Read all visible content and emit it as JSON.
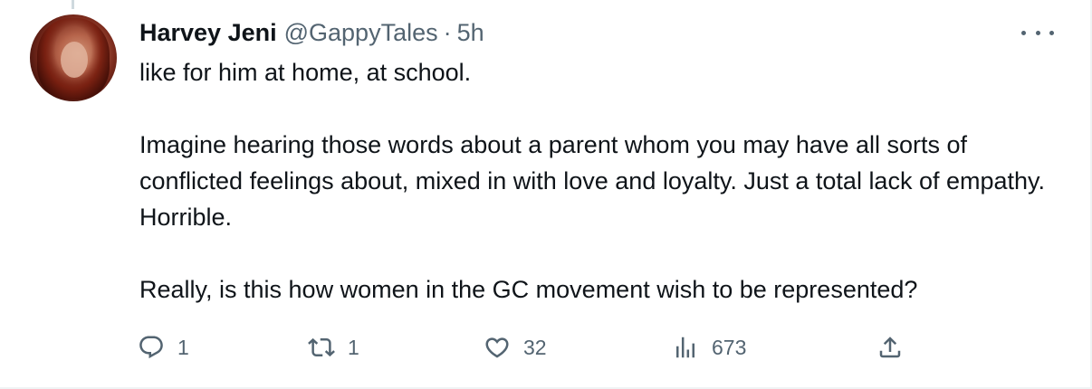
{
  "tweet": {
    "author_name": "Harvey Jeni",
    "handle": "@GappyTales",
    "separator": "·",
    "time": "5h",
    "paragraphs": [
      "like for him at home, at school.",
      "Imagine hearing those words about a parent whom you may have all sorts of conflicted feelings about, mixed in with love and loyalty. Just a total lack of empathy. Horrible.",
      "Really, is this how women in the GC movement wish to be represented?"
    ],
    "stats": {
      "replies": "1",
      "retweets": "1",
      "likes": "32",
      "views": "673"
    }
  },
  "icons": {
    "more": "more-horizontal-icon",
    "reply": "reply-icon",
    "retweet": "retweet-icon",
    "like": "heart-icon",
    "views": "views-icon",
    "share": "share-icon"
  },
  "colors": {
    "text": "#0f1419",
    "secondary": "#536471",
    "border": "#eff3f4"
  }
}
